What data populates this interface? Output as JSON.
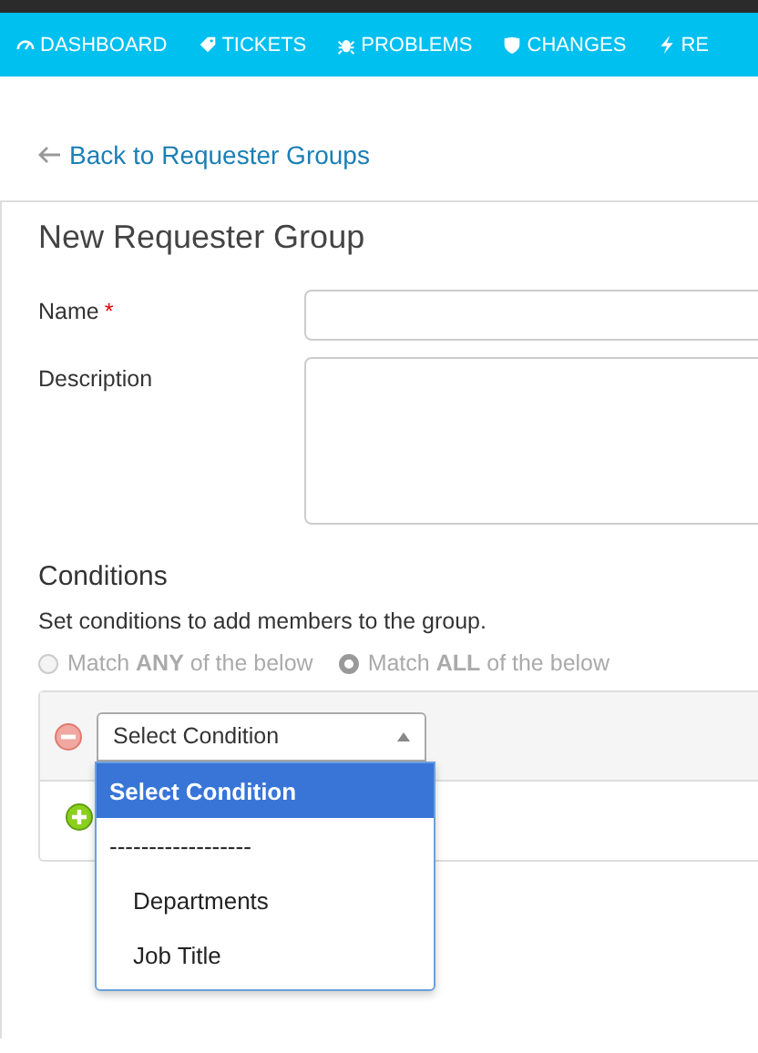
{
  "nav": [
    {
      "label": "DASHBOARD"
    },
    {
      "label": "TICKETS"
    },
    {
      "label": "PROBLEMS"
    },
    {
      "label": "CHANGES"
    },
    {
      "label": "RE"
    }
  ],
  "back_link": "Back to Requester Groups",
  "title": "New Requester Group",
  "fields": [
    {
      "label": "Name",
      "required_mark": "*",
      "kind": "input"
    },
    {
      "label": "Description",
      "kind": "textarea"
    }
  ],
  "conditions": {
    "heading": "Conditions",
    "hint": "Set conditions to add members to the group.",
    "match": [
      {
        "label": "Match **ANY** of the below",
        "selected": false,
        "disabled": true
      },
      {
        "label": "Match **ALL** of the below",
        "selected": true,
        "disabled": true
      }
    ],
    "select": {
      "value": "Select Condition",
      "expanded": true,
      "options": [
        {
          "label": "Select Condition",
          "selected": true
        },
        {
          "label": "------------------",
          "selected": false,
          "children": [
            {
              "label": "Departments",
              "selected": false
            },
            {
              "label": "Job Title",
              "selected": false
            }
          ]
        }
      ]
    }
  }
}
